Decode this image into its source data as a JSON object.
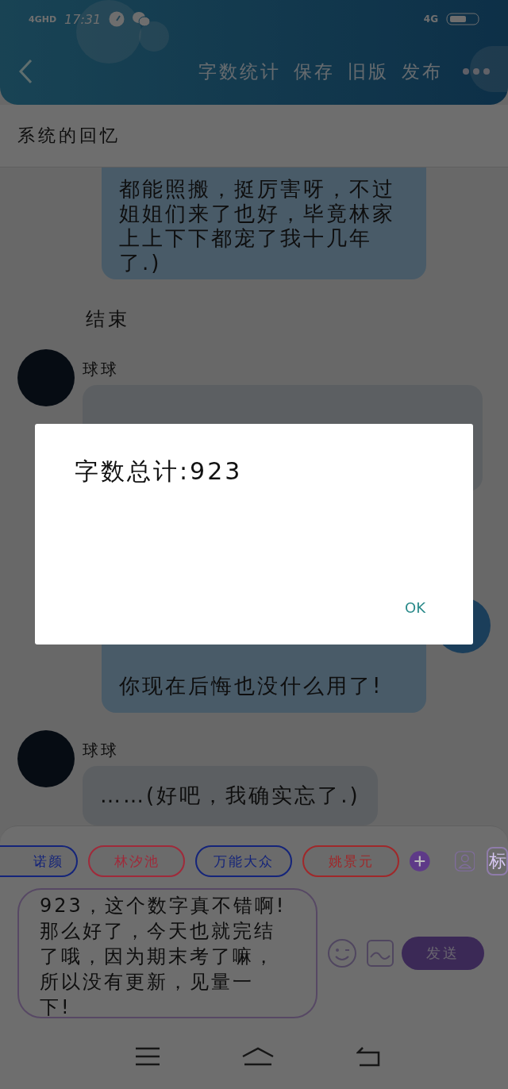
{
  "status_bar": {
    "network_left": "4GHD",
    "time": "17:31",
    "network_right": "4G"
  },
  "header": {
    "actions": [
      "字数统计",
      "保存",
      "旧版",
      "发布"
    ]
  },
  "title": "系统的回忆",
  "chat": [
    {
      "kind": "bubble-right",
      "lines": [
        "都能照搬，挺厉害呀，不过",
        "姐姐们来了也好，毕竟林家",
        "上上下下都宠了我十几年",
        "了.)"
      ]
    },
    {
      "kind": "narration",
      "text": "结束"
    },
    {
      "kind": "message-left",
      "sender": "球球"
    },
    {
      "kind": "message-right",
      "text": "你现在后悔也没什么用了!"
    },
    {
      "kind": "message-left",
      "sender": "球球",
      "text": "……(好吧，我确实忘了.)"
    }
  ],
  "composer": {
    "chips": [
      {
        "label": "诺颜",
        "color": "#14247a"
      },
      {
        "label": "林汐池",
        "color": "#a02a3a"
      },
      {
        "label": "万能大众",
        "color": "#14247a"
      },
      {
        "label": "姚景元",
        "color": "#a0282a"
      }
    ],
    "tag_label": "标",
    "input_lines": [
      "923，这个数字真不错啊!",
      "那么好了，今天也就完结",
      "了哦，因为期末考了嘛，",
      "所以没有更新，见量一",
      "下!"
    ],
    "send_label": "发送"
  },
  "dialog": {
    "message": "字数总计:923",
    "button": "OK"
  }
}
